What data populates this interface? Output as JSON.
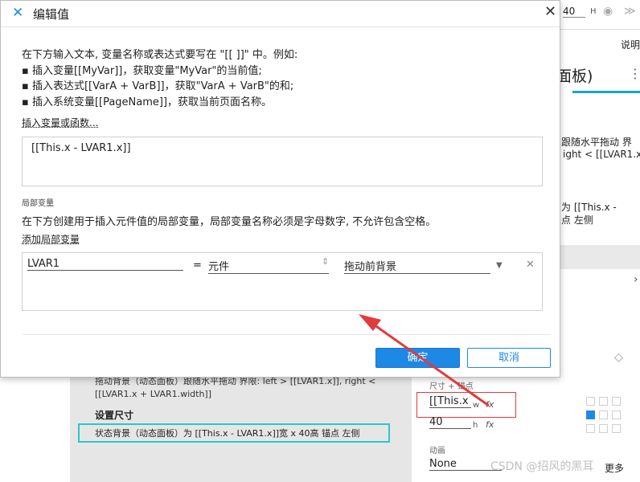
{
  "dialog": {
    "title": "编辑值",
    "intro": [
      "在下方输入文本, 变量名称或表达式要写在 \"[[ ]]\" 中。例如:",
      "▪ 插入变量[[MyVar]]，获取变量\"MyVar\"的当前值;",
      "▪ 插入表达式[[VarA + VarB]]，获取\"VarA + VarB\"的和;",
      "▪ 插入系统变量[[PageName]]，获取当前页面名称。"
    ],
    "insert_link": "插入变量或函数...",
    "expression": "[[This.x - LVAR1.x]]",
    "local_vars_heading": "局部变量",
    "local_vars_desc": "在下方创建用于插入元件值的局部变量，局部变量名称必须是字母数字, 不允许包含空格。",
    "add_local_link": "添加局部变量",
    "local_var": {
      "name": "LVAR1",
      "equals": "=",
      "type": "元件",
      "target": "拖动前背景"
    },
    "ok_label": "确定",
    "cancel_label": "取消"
  },
  "background": {
    "top_value": "40",
    "h_label": "H",
    "explain_tab": "说明",
    "panel_title": "面板)",
    "right_text_1": "跟随水平拖动 界",
    "right_text_2": "ight < [[LVAR1.x +",
    "right_text_3": "为 [[This.x -",
    "right_text_4": "点 左侧",
    "interaction_text_1": "拖动背景（动态面板）跟随水平拖动 界限: left > [[LVAR1.x]], right <",
    "interaction_text_2": "[[LVAR1.x + LVAR1.width]]",
    "set_size_heading": "设置尺寸",
    "set_size_detail": "状态背景（动态面板）为 [[This.x - LVAR1.x]]宽 x 40高 锚点 左侧",
    "size_anchor_label": "尺寸 + 锚点",
    "width_field": "[[This.x -",
    "w_label": "w",
    "height_field": "40",
    "h_small": "h",
    "animation_label": "动画",
    "animation_value": "None",
    "more_label": "更多",
    "watermark": "CSDN @招风的黑耳"
  },
  "colors": {
    "primary": "#1e88e5",
    "annotation_red": "#e23b3b",
    "highlight_teal": "#2cc7c7"
  }
}
